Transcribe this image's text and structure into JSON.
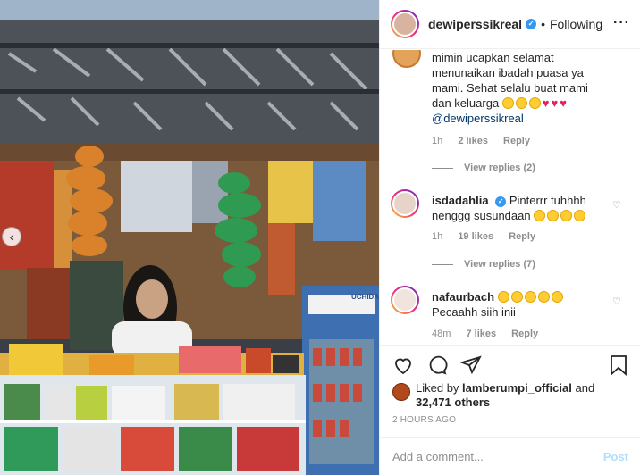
{
  "header": {
    "username": "dewiperssikreal",
    "separator": "•",
    "follow_state": "Following",
    "more_icon": "more-horizontal-icon"
  },
  "comments": [
    {
      "text_lines": [
        "mimin ucapkan selamat",
        "menunaikan ibadah puasa ya",
        "mami. Sehat selalu buat mami",
        "dan keluarga"
      ],
      "mention": "@dewiperssikreal",
      "time": "1h",
      "likes": "2 likes",
      "reply": "Reply",
      "view_replies": "View replies (2)"
    },
    {
      "username": "isdadahlia",
      "text": "Pinterrr tuhhhh",
      "text2": "nenggg susundaan",
      "time": "1h",
      "likes": "19 likes",
      "reply": "Reply",
      "view_replies": "View replies (7)"
    },
    {
      "username": "nafaurbach",
      "text": "Pecaahh siih inii",
      "time": "48m",
      "likes": "7 likes",
      "reply": "Reply"
    }
  ],
  "liked_by": {
    "prefix": "Liked by",
    "user": "lamberumpi_official",
    "and": "and",
    "others": "32,471 others"
  },
  "timestamp": "2 HOURS AGO",
  "comment_input": {
    "placeholder": "Add a comment...",
    "post_label": "Post"
  },
  "media": {
    "nav_prev": "‹",
    "sign_text": "UCHIDA"
  }
}
